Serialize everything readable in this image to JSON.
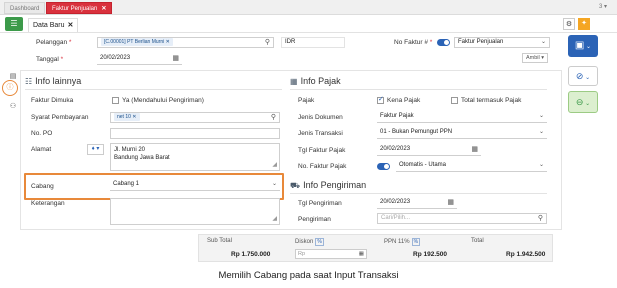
{
  "tabs": {
    "dashboard": "Dashboard",
    "faktur_penjualan": "Faktur Penjualan",
    "count": "3"
  },
  "doc_tab": "Data Baru",
  "header": {
    "pelanggan_label": "Pelanggan",
    "pelanggan_value": "[C.00001] PT Berlian Murni",
    "currency": "IDR",
    "no_faktur_label": "No Faktur #",
    "no_faktur_value": "Faktur Penjualan",
    "tanggal_label": "Tanggal",
    "tanggal_value": "20/02/2023",
    "ambil_label": "Ambil"
  },
  "info_lainnya": {
    "title": "Info lainnya",
    "faktur_dimuka_label": "Faktur Dimuka",
    "faktur_dimuka_option": "Ya (Mendahului Pengiriman)",
    "syarat_label": "Syarat Pembayaran",
    "syarat_value": "net 10",
    "no_po_label": "No. PO",
    "alamat_label": "Alamat",
    "alamat_line1": "Jl. Murni 20",
    "alamat_line2": "Bandung Jawa Barat",
    "cabang_label": "Cabang",
    "cabang_value": "Cabang 1",
    "keterangan_label": "Keterangan"
  },
  "info_pajak": {
    "title": "Info Pajak",
    "pajak_label": "Pajak",
    "kena_pajak": "Kena Pajak",
    "total_termasuk_pajak": "Total termasuk Pajak",
    "jenis_dokumen_label": "Jenis Dokumen",
    "jenis_dokumen_value": "Faktur Pajak",
    "jenis_transaksi_label": "Jenis Transaksi",
    "jenis_transaksi_value": "01 - Bukan Pemungut PPN",
    "tgl_faktur_label": "Tgl Faktur Pajak",
    "tgl_faktur_value": "20/02/2023",
    "no_faktur_pajak_label": "No. Faktur Pajak",
    "no_faktur_pajak_value": "Otomatis - Utama"
  },
  "info_pengiriman": {
    "title": "Info Pengiriman",
    "tgl_pengiriman_label": "Tgl Pengiriman",
    "tgl_pengiriman_value": "20/02/2023",
    "pengiriman_label": "Pengiriman",
    "pengiriman_placeholder": "Cari/Pilih..."
  },
  "totals": {
    "sub_total_label": "Sub Total",
    "sub_total_value": "Rp 1.750.000",
    "diskon_label": "Diskon",
    "diskon_pct": "%",
    "diskon_placeholder": "Rp",
    "ppn_label": "PPN 11%",
    "ppn_pct": "%",
    "ppn_value": "Rp 192.500",
    "total_label": "Total",
    "total_value": "Rp 1.942.500"
  },
  "caption": "Memilih Cabang pada saat Input Transaksi",
  "colors": {
    "accent_red": "#d9313d",
    "primary_blue": "#2b63b6",
    "highlight_orange": "#e8893a",
    "green": "#3c9a4a"
  }
}
